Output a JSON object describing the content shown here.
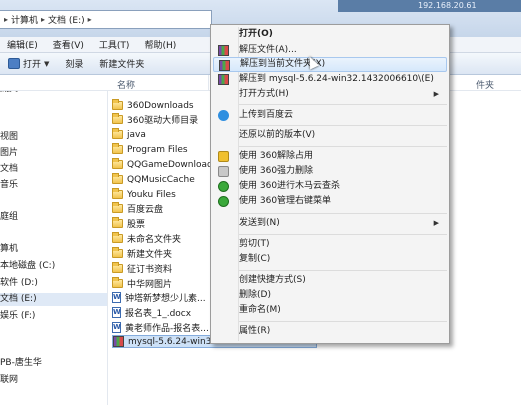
{
  "address": {
    "segments": [
      "计算机",
      "文档 (E:)"
    ],
    "separator": "▸"
  },
  "remote": {
    "ip": "192.168.20.61"
  },
  "menubar": {
    "items": [
      "编辑(E)",
      "查看(V)",
      "工具(T)",
      "帮助(H)"
    ]
  },
  "toolbar": {
    "open_label": "打开",
    "burn_label": "刻录",
    "new_folder_label": "新建文件夹"
  },
  "columns": {
    "name": "名称",
    "type": "件夹"
  },
  "nav": {
    "items": [
      "藏夹",
      "视图",
      "图片",
      "文档",
      "音乐",
      "庭组",
      "算机",
      "本地磁盘 (C:)",
      "软件 (D:)",
      "文档 (E:)",
      "娱乐 (F:)",
      "PB-唐生华",
      "联网"
    ],
    "selected_index": 9
  },
  "files": [
    {
      "name": "360Downloads",
      "icon": "folder-icon"
    },
    {
      "name": "360驱动大师目录",
      "icon": "folder-icon"
    },
    {
      "name": "java",
      "icon": "folder-icon"
    },
    {
      "name": "Program Files",
      "icon": "folder-icon"
    },
    {
      "name": "QQGameDownload",
      "icon": "folder-icon"
    },
    {
      "name": "QQMusicCache",
      "icon": "folder-icon"
    },
    {
      "name": "Youku Files",
      "icon": "folder-icon"
    },
    {
      "name": "百度云盘",
      "icon": "folder-icon"
    },
    {
      "name": "股票",
      "icon": "folder-icon"
    },
    {
      "name": "未命名文件夹",
      "icon": "folder-icon"
    },
    {
      "name": "新建文件夹",
      "icon": "folder-icon"
    },
    {
      "name": "征订书资料",
      "icon": "folder-icon"
    },
    {
      "name": "中华网图片",
      "icon": "folder-icon"
    },
    {
      "name": "钟塔新梦想少儿素...",
      "icon": "word-doc-icon"
    },
    {
      "name": "报名表_1_.docx",
      "icon": "word-doc-icon"
    },
    {
      "name": "黄老师作品-报名表...",
      "icon": "word-doc-icon"
    },
    {
      "name": "mysql-5.6.24-win3...",
      "icon": "winrar-archive-icon",
      "selected": true
    }
  ],
  "context_menu": {
    "items": [
      {
        "label": "打开(O)",
        "bold": true
      },
      {
        "label": "解压文件(A)...",
        "icon": "winrar-icon"
      },
      {
        "label": "解压到当前文件夹(X)",
        "icon": "winrar-icon",
        "highlighted": true
      },
      {
        "label": "解压到 mysql-5.6.24-win32.1432006610\\(E)",
        "icon": "winrar-icon"
      },
      {
        "label": "打开方式(H)",
        "submenu": true
      },
      {
        "label": "上传到百度云",
        "icon": "baidu-cloud-icon"
      },
      {
        "label": "还原以前的版本(V)"
      },
      {
        "label": "使用 360解除占用",
        "icon": "360-icon"
      },
      {
        "label": "使用 360强力删除",
        "icon": "360-shred-icon"
      },
      {
        "label": "使用 360进行木马云查杀",
        "icon": "360-scan-icon"
      },
      {
        "label": "使用 360管理右键菜单",
        "icon": "360-scan-icon"
      },
      {
        "label": "发送到(N)",
        "submenu": true
      },
      {
        "label": "剪切(T)"
      },
      {
        "label": "复制(C)"
      },
      {
        "label": "创建快捷方式(S)"
      },
      {
        "label": "删除(D)"
      },
      {
        "label": "重命名(M)"
      },
      {
        "label": "属性(R)"
      }
    ]
  }
}
